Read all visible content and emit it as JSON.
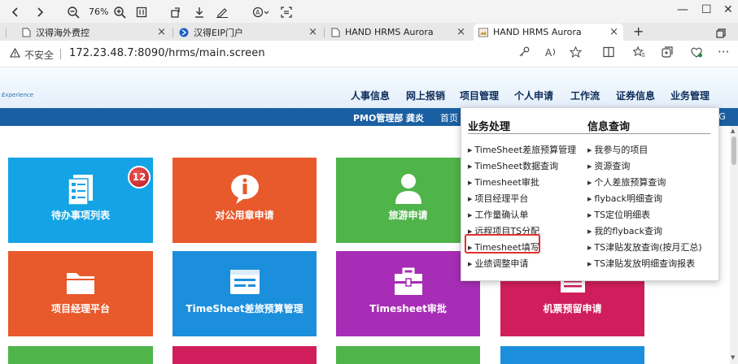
{
  "toolbar": {
    "zoom": "76%",
    "buttons": [
      "back-icon",
      "forward-icon",
      "zoom-out-icon",
      "zoom-in-icon",
      "fit-page-icon",
      "rotate-icon",
      "download-icon",
      "draw-icon",
      "read-aloud-icon",
      "capture-icon"
    ]
  },
  "window": {
    "minimize": "—",
    "maximize": "☐",
    "close": "✕"
  },
  "tabs": [
    {
      "title": "汉得海外费控",
      "active": false
    },
    {
      "title": "汉得EIP门户",
      "active": false
    },
    {
      "title": "HAND HRMS Aurora",
      "active": false
    },
    {
      "title": "HAND HRMS Aurora",
      "active": true
    }
  ],
  "address": {
    "security": "不安全",
    "url": "172.23.48.7:8090/hrms/main.screen"
  },
  "header": {
    "logo_fragment": "Experience",
    "nav": [
      "人事信息",
      "网上报销",
      "项目管理",
      "个人申请",
      "工作流",
      "证券信息",
      "业务管理"
    ],
    "subnav": {
      "dept": "PMO管理部",
      "user": "龚炎",
      "home": "首页",
      "right_fragment": "IG"
    }
  },
  "tiles": [
    {
      "label": "待办事项列表",
      "color": "#14a4e6",
      "icon": "document-list-icon",
      "badge": "12"
    },
    {
      "label": "对公用章申请",
      "color": "#e8592b",
      "icon": "info-bubble-icon"
    },
    {
      "label": "旅游申请",
      "color": "#4fb44a",
      "icon": "person-icon"
    },
    {
      "label": "项目经理平台",
      "color": "#e8592b",
      "icon": "folder-icon"
    },
    {
      "label": "TimeSheet差旅预算管理",
      "color": "#1c8fdc",
      "icon": "form-card-icon"
    },
    {
      "label": "Timesheet审批",
      "color": "#a72db6",
      "icon": "toolbox-icon"
    },
    {
      "label": "机票预留申请",
      "color": "#d01e5c",
      "icon": "list-icon"
    }
  ],
  "dropdown": {
    "left_title": "业务处理",
    "right_title": "信息查询",
    "left_items": [
      "TimeSheet差旅预算管理",
      "TimeSheet数据查询",
      "Timesheet审批",
      "项目经理平台",
      "工作量确认单",
      "远程项目TS分配",
      "Timesheet填写",
      "业绩调整申请"
    ],
    "right_items": [
      "我参与的项目",
      "资源查询",
      "个人差旅预算查询",
      "flyback明细查询",
      "TS定位明细表",
      "我的flyback查询",
      "TS津贴发放查询(按月汇总)",
      "TS津贴发放明细查询报表"
    ],
    "highlighted": "Timesheet填写"
  }
}
